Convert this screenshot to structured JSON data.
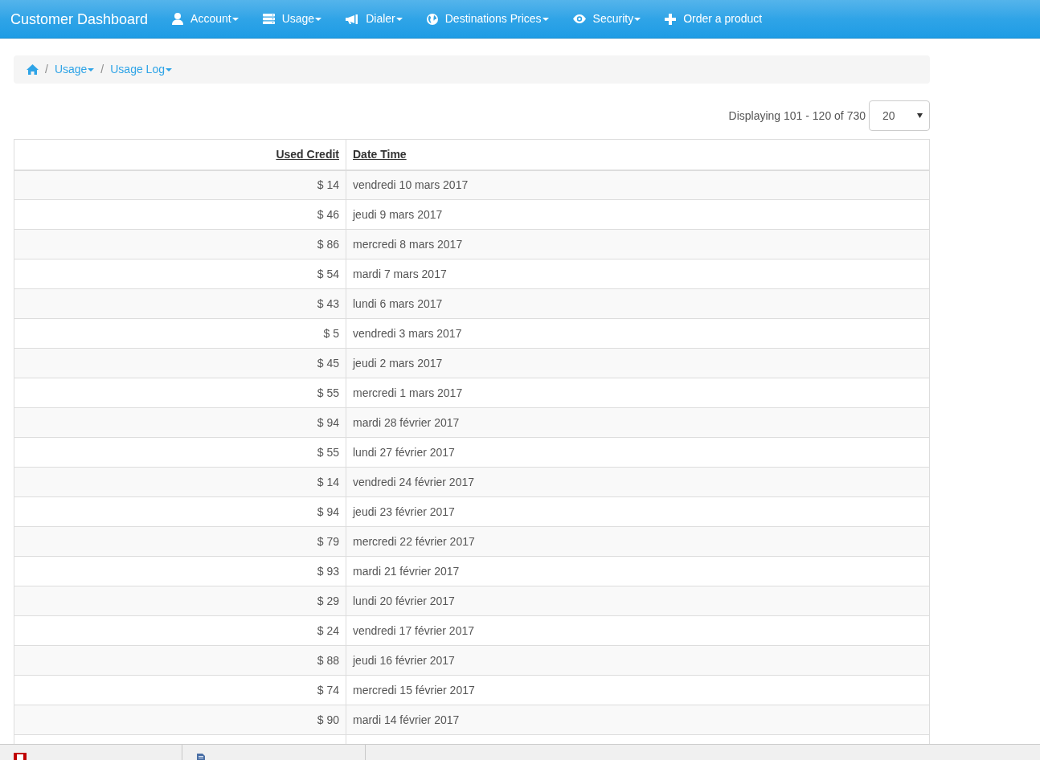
{
  "navbar": {
    "brand": "Customer Dashboard",
    "items": [
      {
        "label": "Account",
        "dropdown": true
      },
      {
        "label": "Usage",
        "dropdown": true
      },
      {
        "label": "Dialer",
        "dropdown": true
      },
      {
        "label": "Destinations Prices",
        "dropdown": true
      },
      {
        "label": "Security",
        "dropdown": true
      },
      {
        "label": "Order a product",
        "dropdown": false
      }
    ]
  },
  "breadcrumb": [
    {
      "separator": "/",
      "label": "Usage",
      "dropdown": true
    },
    {
      "separator": "/",
      "label": "Usage Log",
      "dropdown": true
    }
  ],
  "pagination": {
    "summary": "Displaying 101 - 120 of 730",
    "page_size": "20"
  },
  "table": {
    "columns": [
      "Used Credit",
      "Date Time"
    ],
    "rows": [
      {
        "used_credit": "$ 14",
        "date_time": "vendredi 10 mars 2017"
      },
      {
        "used_credit": "$ 46",
        "date_time": "jeudi 9 mars 2017"
      },
      {
        "used_credit": "$ 86",
        "date_time": "mercredi 8 mars 2017"
      },
      {
        "used_credit": "$ 54",
        "date_time": "mardi 7 mars 2017"
      },
      {
        "used_credit": "$ 43",
        "date_time": "lundi 6 mars 2017"
      },
      {
        "used_credit": "$ 5",
        "date_time": "vendredi 3 mars 2017"
      },
      {
        "used_credit": "$ 45",
        "date_time": "jeudi 2 mars 2017"
      },
      {
        "used_credit": "$ 55",
        "date_time": "mercredi 1 mars 2017"
      },
      {
        "used_credit": "$ 94",
        "date_time": "mardi 28 février 2017"
      },
      {
        "used_credit": "$ 55",
        "date_time": "lundi 27 février 2017"
      },
      {
        "used_credit": "$ 14",
        "date_time": "vendredi 24 février 2017"
      },
      {
        "used_credit": "$ 94",
        "date_time": "jeudi 23 février 2017"
      },
      {
        "used_credit": "$ 79",
        "date_time": "mercredi 22 février 2017"
      },
      {
        "used_credit": "$ 93",
        "date_time": "mardi 21 février 2017"
      },
      {
        "used_credit": "$ 29",
        "date_time": "lundi 20 février 2017"
      },
      {
        "used_credit": "$ 24",
        "date_time": "vendredi 17 février 2017"
      },
      {
        "used_credit": "$ 88",
        "date_time": "jeudi 16 février 2017"
      },
      {
        "used_credit": "$ 74",
        "date_time": "mercredi 15 février 2017"
      },
      {
        "used_credit": "$ 90",
        "date_time": "mardi 14 février 2017"
      }
    ]
  }
}
